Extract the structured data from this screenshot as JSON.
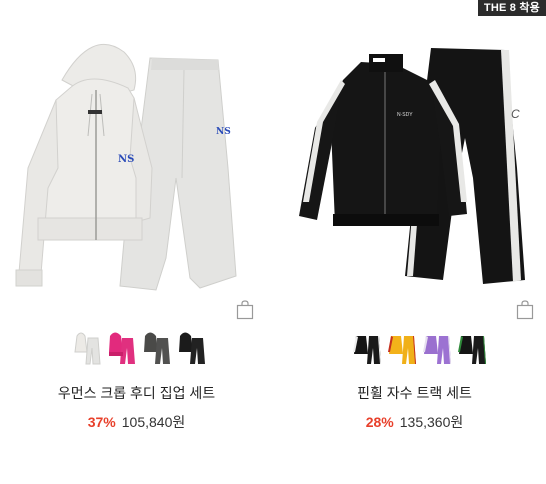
{
  "badge": "THE 8 착용",
  "products": [
    {
      "name": "우먼스 크롭 후디 집업 세트",
      "discount": "37%",
      "price": "105,840원",
      "swatches": [
        "oatmeal-melange",
        "pink",
        "charcoal",
        "black"
      ]
    },
    {
      "name": "핀휠 자수 트랙 세트",
      "discount": "28%",
      "price": "135,360원",
      "swatches": [
        "black",
        "yellow",
        "purple",
        "black-green"
      ]
    }
  ],
  "colors": {
    "discount": "#e8402b",
    "badge_bg": "#2b2b2b"
  }
}
